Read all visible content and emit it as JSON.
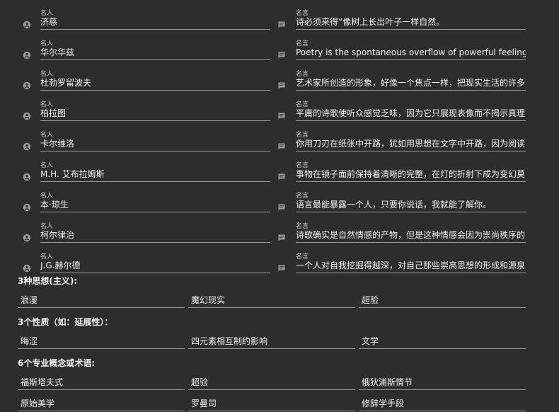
{
  "labels": {
    "name": "名人",
    "quote": "名言"
  },
  "rows": [
    {
      "name": "济慈",
      "quote": "诗必须来得“像树上长出叶子一样自然。"
    },
    {
      "name": "华尔华兹",
      "quote": "Poetry is the spontaneous overflow of powerful feelings."
    },
    {
      "name": "杜勃罗留波夫",
      "quote": "艺术家所创造的形象，好像一个焦点一样，把现实生活的许多"
    },
    {
      "name": "柏拉图",
      "quote": "平庸的诗歌使听众感觉乏味，因为它只展现表像而不揭示真理"
    },
    {
      "name": "卡尔维洛",
      "quote": "你用刀刃在纸张中开路，犹如用思想在文字中开路，因为阅读"
    },
    {
      "name": "M.H. 艾布拉姆斯",
      "quote": "事物在镜子面前保持着清晰的完整，在灯的折射下成为变幻莫"
    },
    {
      "name": "本·琼生",
      "quote": "语言最能暴露一个人，只要你说话，我就能了解你。"
    },
    {
      "name": "柯尔律治",
      "quote": "诗歌确实是自然情感的产物，但是这种情感会因为崇尚秩序的"
    },
    {
      "name": "J.G.赫尔德",
      "quote": "一个人对自我挖掘得越深，对自己那些崇高思想的形成和源泉"
    }
  ],
  "sections": [
    {
      "title": "3种思想(主义):",
      "items": [
        "浪漫",
        "魔幻现实",
        "超验"
      ]
    },
    {
      "title": "3个性质（如：延展性）：",
      "items": [
        "晦涩",
        "四元素相互制约影响",
        "文学"
      ]
    },
    {
      "title": "6个专业概念或术语:",
      "items": [
        "福斯塔夫式",
        "超验",
        "俄狄浦斯情节",
        "原始美学",
        "罗曼司",
        "修辞学手段"
      ]
    }
  ],
  "icons": {
    "person": "person-circle-icon",
    "quote": "comment-icon"
  },
  "colors": {
    "background": "#2d2d2d",
    "text": "#f0f0f0",
    "underline": "#9a9a9a"
  }
}
